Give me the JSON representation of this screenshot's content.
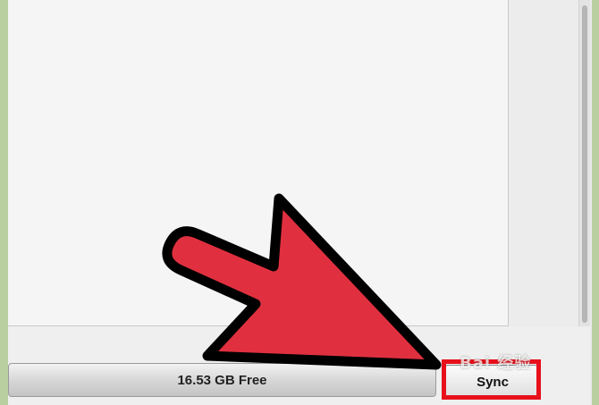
{
  "storage": {
    "free_label": "16.53 GB Free"
  },
  "actions": {
    "sync_label": "Sync"
  },
  "overlay": {
    "arrow_color": "#e0303f",
    "highlight_color": "#e8101a",
    "watermark_text": "Bai 经验"
  },
  "colors": {
    "frame_border": "#b9cfa0",
    "pane_background": "#f5f5f5"
  }
}
